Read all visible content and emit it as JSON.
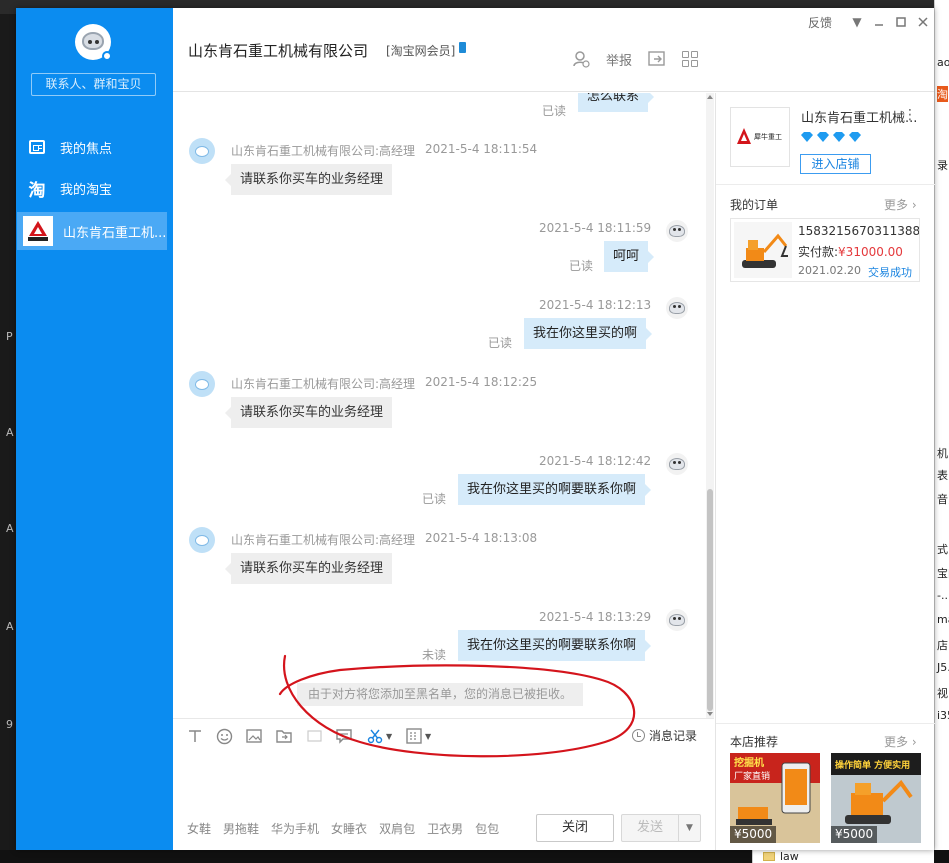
{
  "window": {
    "title": "山东肯石重工机械有限公司",
    "member_tag": "[淘宝网会员]",
    "feedback_label": "反馈"
  },
  "sidebar": {
    "search_placeholder": "联系人、群和宝贝",
    "items": [
      {
        "label": "我的焦点",
        "icon": "focus-icon"
      },
      {
        "label": "我的淘宝",
        "icon": "taobao-icon"
      },
      {
        "label": "山东肯石重工机...",
        "icon": "shop-logo"
      }
    ]
  },
  "header_tools": {
    "report_label": "举报"
  },
  "messages": [
    {
      "side": "right",
      "read": "已读",
      "text": "怎么联系"
    },
    {
      "side": "left",
      "sender": "山东肯石重工机械有限公司:高经理",
      "time": "2021-5-4 18:11:54",
      "text": "请联系你买车的业务经理"
    },
    {
      "side": "right",
      "time": "2021-5-4 18:11:59",
      "read": "已读",
      "text": "呵呵"
    },
    {
      "side": "right",
      "time": "2021-5-4 18:12:13",
      "read": "已读",
      "text": "我在你这里买的啊"
    },
    {
      "side": "left",
      "sender": "山东肯石重工机械有限公司:高经理",
      "time": "2021-5-4 18:12:25",
      "text": "请联系你买车的业务经理"
    },
    {
      "side": "right",
      "time": "2021-5-4 18:12:42",
      "read": "已读",
      "text": "我在你这里买的啊要联系你啊"
    },
    {
      "side": "left",
      "sender": "山东肯石重工机械有限公司:高经理",
      "time": "2021-5-4 18:13:08",
      "text": "请联系你买车的业务经理"
    },
    {
      "side": "right",
      "time": "2021-5-4 18:13:29",
      "read": "未读",
      "text": "我在你这里买的啊要联系你啊"
    }
  ],
  "system_notice": "由于对方将您添加至黑名单，您的消息已被拒收。",
  "toolbar": {
    "history_label": "消息记录"
  },
  "quick_tags": [
    "女鞋",
    "男拖鞋",
    "华为手机",
    "女睡衣",
    "双肩包",
    "卫衣男",
    "包包"
  ],
  "buttons": {
    "close": "关闭",
    "send": "发送"
  },
  "right_panel": {
    "shop_name": "山东肯石重工机械...",
    "diamonds": "💎💎💎💎",
    "enter_shop": "进入店铺",
    "orders_heading": "我的订单",
    "more": "更多",
    "order": {
      "number": "1583215670311388",
      "pay_label": "实付款:",
      "pay_value": "¥31000.00",
      "date": "2021.02.20",
      "status": "交易成功"
    },
    "recommend_heading": "本店推荐",
    "recommendations": [
      {
        "price": "¥5000",
        "caption": "挖掘机 厂家直销"
      },
      {
        "price": "¥5000",
        "caption": "操作简单 方便实用"
      }
    ]
  },
  "background": {
    "right_fragments": [
      "ao",
      "淘",
      "录",
      "机",
      "表",
      "音,",
      "式.",
      "宝[",
      "-...",
      "ma",
      "店",
      "J5.",
      "视",
      "i35"
    ],
    "left_fragments": [
      "P",
      "A",
      "A",
      "A",
      "9"
    ],
    "bottom_file": "law"
  },
  "colors": {
    "sidebar": "#0b8cf0",
    "sidebar_active": "#4aa9f5",
    "bubble_self": "#d6ebfa",
    "bubble_other": "#eeeeee",
    "price_red": "#e4393c",
    "link_blue": "#1a84e0",
    "annotation_red": "#d4141c"
  }
}
